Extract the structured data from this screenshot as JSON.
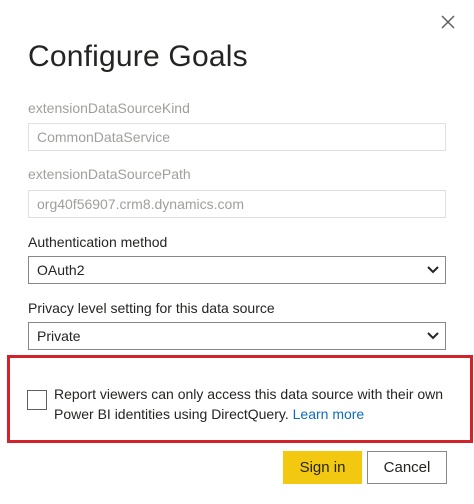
{
  "dialog": {
    "title": "Configure Goals"
  },
  "fields": {
    "kind_label": "extensionDataSourceKind",
    "kind_value": "CommonDataService",
    "path_label": "extensionDataSourcePath",
    "path_value": "org40f56907.crm8.dynamics.com",
    "auth_label": "Authentication method",
    "auth_value": "OAuth2",
    "privacy_label": "Privacy level setting for this data source",
    "privacy_value": "Private"
  },
  "checkbox": {
    "checked": false,
    "text": "Report viewers can only access this data source with their own Power BI identities using DirectQuery.",
    "link_text": "Learn more"
  },
  "buttons": {
    "sign_in": "Sign in",
    "cancel": "Cancel"
  },
  "colors": {
    "primary_button": "#f2c811",
    "highlight_border": "#d2232a",
    "link": "#0f6cbd"
  },
  "icons": {
    "close": "close-icon",
    "dropdown": "chevron-down-icon"
  }
}
